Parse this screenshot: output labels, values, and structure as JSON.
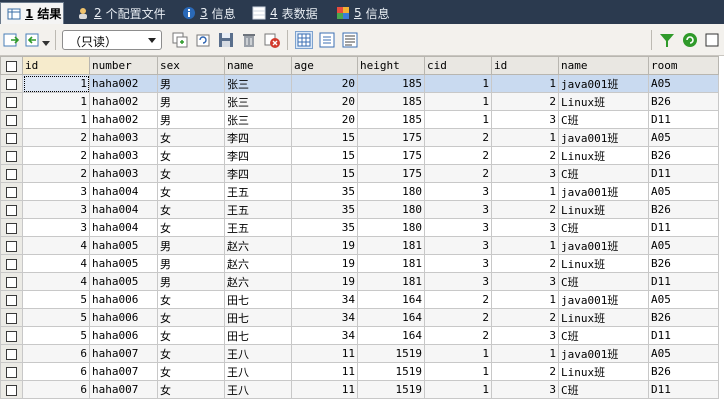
{
  "tabs": [
    {
      "num": "1",
      "label": "结果",
      "icon": "grid-result-icon",
      "active": true
    },
    {
      "num": "2",
      "label": "个配置文件",
      "icon": "profile-icon",
      "active": false
    },
    {
      "num": "3",
      "label": "信息",
      "icon": "info-icon",
      "active": false
    },
    {
      "num": "4",
      "label": "表数据",
      "icon": "table-data-icon",
      "active": false
    },
    {
      "num": "5",
      "label": "信息",
      "icon": "info-history-icon",
      "active": false
    }
  ],
  "toolbar": {
    "readonly_select": "（只读）",
    "icons_left": [
      "export-icon",
      "import-icon"
    ],
    "icons_edit": [
      "duplicate-row-icon",
      "refresh-row-icon",
      "save-icon",
      "delete-icon",
      "cancel-icon"
    ],
    "icons_view": [
      "grid-view-icon",
      "form-view-icon",
      "text-view-icon"
    ],
    "icons_right": [
      "filter-icon",
      "refresh-icon",
      "checkbox-icon"
    ]
  },
  "colors": {
    "tabbar": "#2b3a4f",
    "selected_row": "#c9daf0",
    "filter_green": "#2f9a2a"
  },
  "grid": {
    "columns": [
      "id",
      "number",
      "sex",
      "name",
      "age",
      "height",
      "cid",
      "id",
      "name",
      "room"
    ],
    "rows": [
      [
        "1",
        "haha002",
        "男",
        "张三",
        "20",
        "185",
        "1",
        "1",
        "java001班",
        "A05"
      ],
      [
        "1",
        "haha002",
        "男",
        "张三",
        "20",
        "185",
        "1",
        "2",
        "Linux班",
        "B26"
      ],
      [
        "1",
        "haha002",
        "男",
        "张三",
        "20",
        "185",
        "1",
        "3",
        "C班",
        "D11"
      ],
      [
        "2",
        "haha003",
        "女",
        "李四",
        "15",
        "175",
        "2",
        "1",
        "java001班",
        "A05"
      ],
      [
        "2",
        "haha003",
        "女",
        "李四",
        "15",
        "175",
        "2",
        "2",
        "Linux班",
        "B26"
      ],
      [
        "2",
        "haha003",
        "女",
        "李四",
        "15",
        "175",
        "2",
        "3",
        "C班",
        "D11"
      ],
      [
        "3",
        "haha004",
        "女",
        "王五",
        "35",
        "180",
        "3",
        "1",
        "java001班",
        "A05"
      ],
      [
        "3",
        "haha004",
        "女",
        "王五",
        "35",
        "180",
        "3",
        "2",
        "Linux班",
        "B26"
      ],
      [
        "3",
        "haha004",
        "女",
        "王五",
        "35",
        "180",
        "3",
        "3",
        "C班",
        "D11"
      ],
      [
        "4",
        "haha005",
        "男",
        "赵六",
        "19",
        "181",
        "3",
        "1",
        "java001班",
        "A05"
      ],
      [
        "4",
        "haha005",
        "男",
        "赵六",
        "19",
        "181",
        "3",
        "2",
        "Linux班",
        "B26"
      ],
      [
        "4",
        "haha005",
        "男",
        "赵六",
        "19",
        "181",
        "3",
        "3",
        "C班",
        "D11"
      ],
      [
        "5",
        "haha006",
        "女",
        "田七",
        "34",
        "164",
        "2",
        "1",
        "java001班",
        "A05"
      ],
      [
        "5",
        "haha006",
        "女",
        "田七",
        "34",
        "164",
        "2",
        "2",
        "Linux班",
        "B26"
      ],
      [
        "5",
        "haha006",
        "女",
        "田七",
        "34",
        "164",
        "2",
        "3",
        "C班",
        "D11"
      ],
      [
        "6",
        "haha007",
        "女",
        "王八",
        "11",
        "1519",
        "1",
        "1",
        "java001班",
        "A05"
      ],
      [
        "6",
        "haha007",
        "女",
        "王八",
        "11",
        "1519",
        "1",
        "2",
        "Linux班",
        "B26"
      ],
      [
        "6",
        "haha007",
        "女",
        "王八",
        "11",
        "1519",
        "1",
        "3",
        "C班",
        "D11"
      ]
    ]
  }
}
